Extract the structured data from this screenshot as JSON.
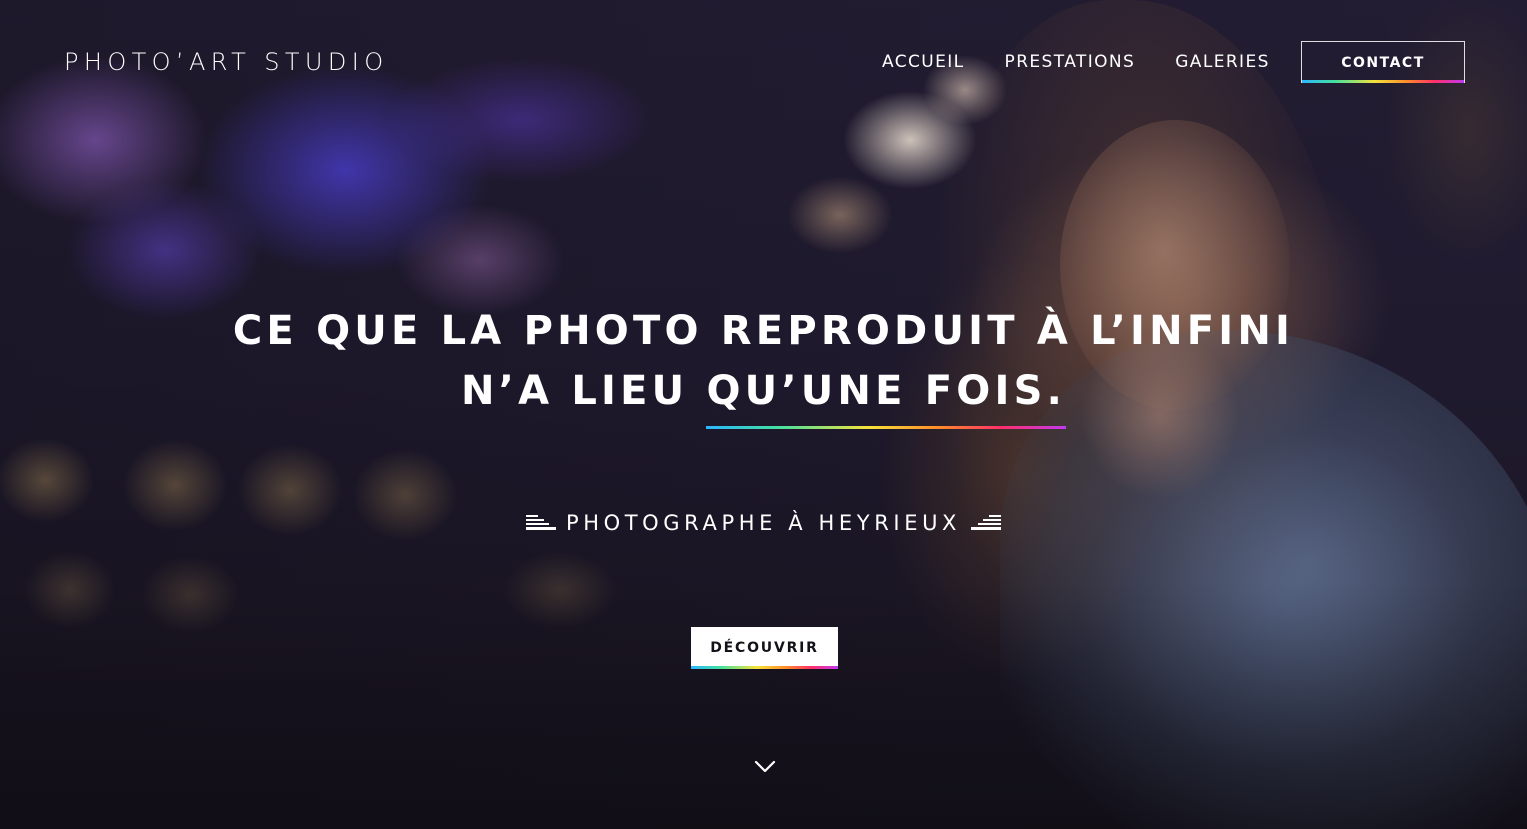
{
  "brand": {
    "logo_text": "PHOTOʼART STUDIO"
  },
  "nav": {
    "items": [
      {
        "label": "ACCUEIL"
      },
      {
        "label": "PRESTATIONS"
      },
      {
        "label": "GALERIES"
      }
    ],
    "contact_label": "CONTACT"
  },
  "hero": {
    "headline_line1": "CE QUE LA PHOTO REPRODUIT À L’INFINI",
    "headline_line2_prefix": "N’A LIEU ",
    "headline_line2_highlight": "QU’UNE FOIS.",
    "subtitle": "PHOTOGRAPHE À HEYRIEUX",
    "cta_label": "DÉCOUVRIR"
  },
  "icons": {
    "subtitle_left": "stripes-left-icon",
    "subtitle_right": "stripes-right-icon",
    "scroll": "chevron-down-icon"
  },
  "colors": {
    "text": "#ffffff",
    "button_bg": "#ffffff",
    "button_text": "#141219",
    "accent_gradient": [
      "#2bb6ff",
      "#44e0a0",
      "#f4e23a",
      "#ff8a2a",
      "#ff2f6a",
      "#c03af0"
    ]
  }
}
